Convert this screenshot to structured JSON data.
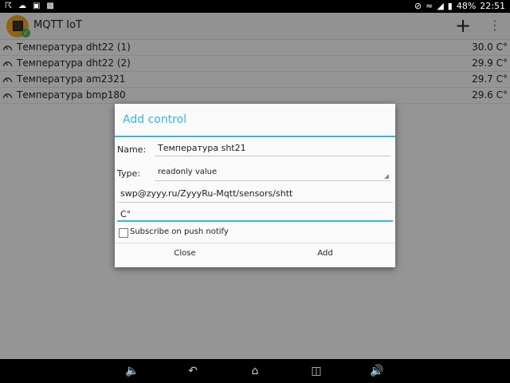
{
  "status_bar": {
    "time": "22:51",
    "battery": "48%"
  },
  "app_bar": {
    "title": "MQTT IoT"
  },
  "sensors": [
    {
      "label": "Температура dht22 (1)",
      "value": "30.0 C°"
    },
    {
      "label": "Температура dht22 (2)",
      "value": "29.9 C°"
    },
    {
      "label": "Температура am2321",
      "value": "29.7 C°"
    },
    {
      "label": "Температура bmp180",
      "value": "29.6 C°"
    }
  ],
  "dialog": {
    "title": "Add control",
    "name_label": "Name:",
    "name_value": "Температура sht21",
    "type_label": "Type:",
    "type_value": "readonly value",
    "topic_value": "swp@zyyy.ru/ZyyyRu-Mqtt/sensors/shtt",
    "unit_value": "C°",
    "subscribe_label": "Subscribe on push notify",
    "subscribe_checked": false,
    "close_label": "Close",
    "add_label": "Add"
  },
  "colors": {
    "accent": "#33b5e5",
    "app_icon": "#e8a020",
    "app_icon_check": "#4caf50"
  }
}
